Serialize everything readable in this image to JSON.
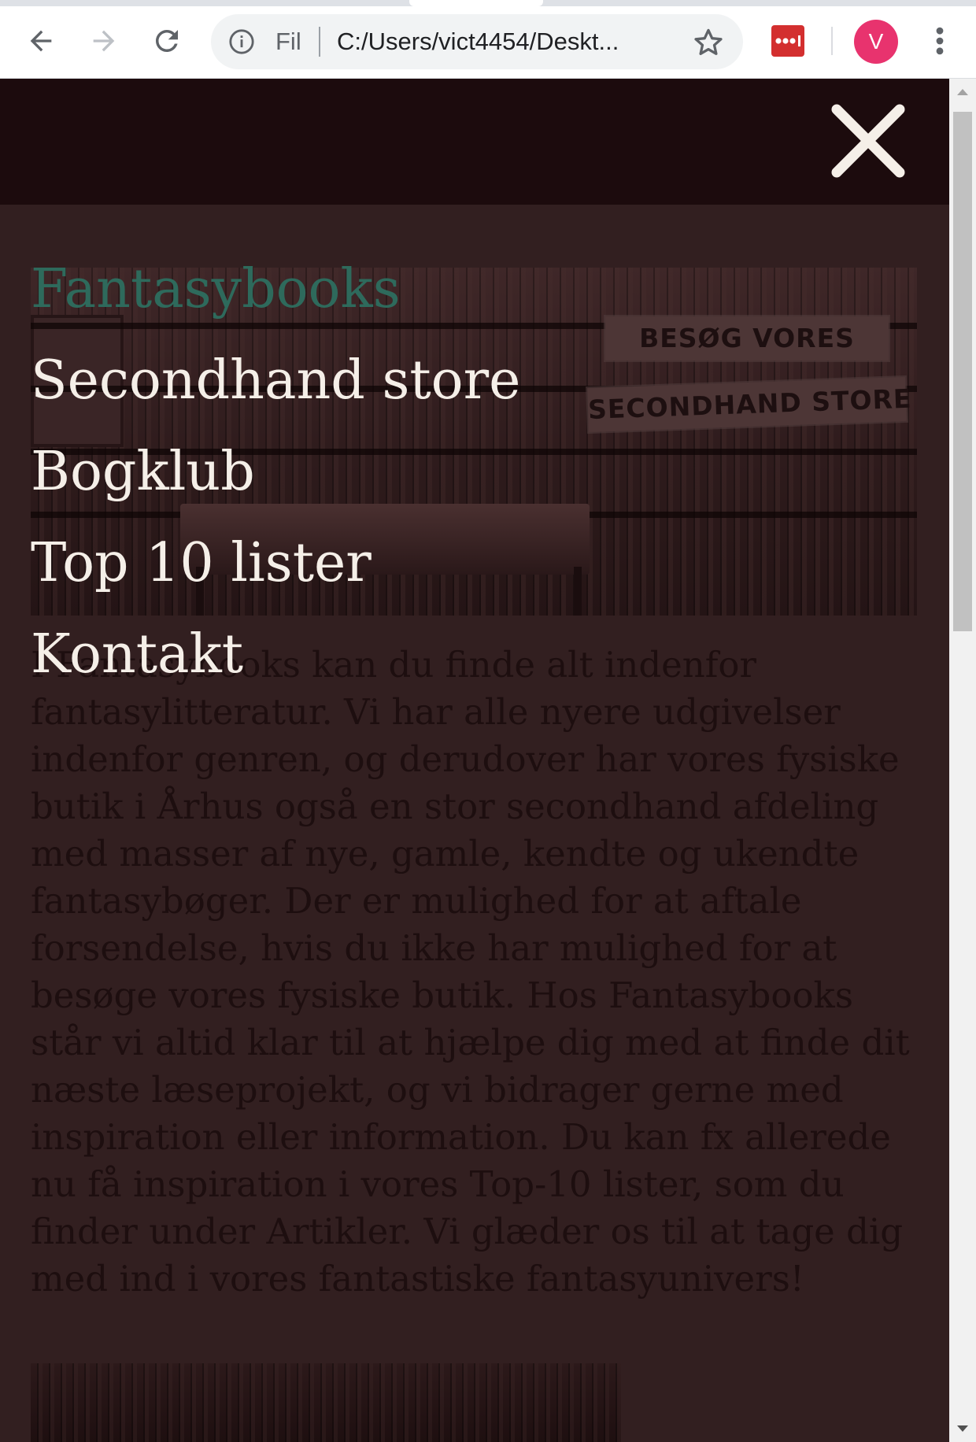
{
  "browser": {
    "omnibox_scheme": "Fil",
    "omnibox_url": "C:/Users/vict4454/Deskt...",
    "avatar_letter": "V",
    "accent_avatar": "#e8336e",
    "extension_color": "#d32f2f",
    "icons": [
      "back-arrow-icon",
      "forward-arrow-icon",
      "reload-icon",
      "info-icon",
      "star-icon",
      "lastpass-icon",
      "kebab-menu-icon"
    ]
  },
  "site": {
    "header_bg": "#1c0b0d",
    "page_bg": "#321f20",
    "close_icon": "close-icon",
    "hero": {
      "sign_line1": "BESØG VORES",
      "sign_line2": "SECONDHAND STORE"
    },
    "intro_text": "I Fantasybooks kan du finde alt indenfor fantasylitteratur. Vi har alle nyere udgivelser indenfor genren, og derudover har vores fysiske butik i Århus også en stor secondhand afdeling med masser af nye, gamle, kendte og ukendte fantasybøger. Der er mulighed for at aftale forsendelse, hvis du ikke har mulighed for at besøge vores fysiske butik. Hos Fantasybooks står vi altid klar til at hjælpe dig med at finde dit næste læseprojekt, og vi bidrager gerne med inspiration eller information. Du kan fx allerede nu få inspiration i vores Top-10 lister, som du finder under Artikler. Vi glæder os til at tage dig med ind i vores fantastiske fantasyunivers!"
  },
  "menu": {
    "brand": "Fantasybooks",
    "brand_color": "#2e6a5c",
    "items": [
      {
        "label": "Secondhand store"
      },
      {
        "label": "Bogklub"
      },
      {
        "label": "Top 10 lister"
      },
      {
        "label": "Kontakt"
      }
    ]
  }
}
